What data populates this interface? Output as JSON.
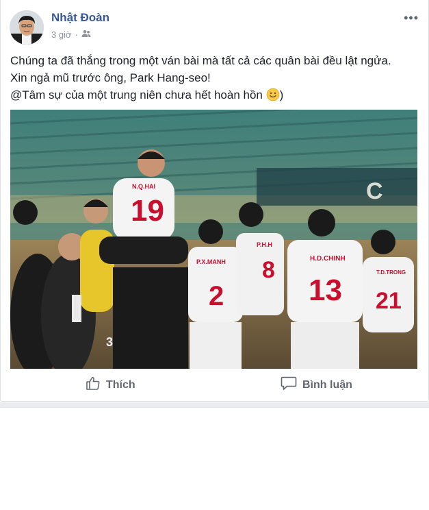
{
  "post": {
    "author": "Nhật Đoàn",
    "time": "3 giờ",
    "separator": "·",
    "privacy_icon": "friends-icon",
    "more_icon": "more-options-icon",
    "more_glyph": "•••",
    "lines": [
      "Chúng ta đã thắng trong một ván bài mà tất cả các quân bài đều lật ngửa.",
      "Xin ngả mũ trước ông, Park Hang-seo!"
    ],
    "line3_before_emoji": "@Tâm sự của một trung niên chưa hết hoàn hồn ",
    "line3_after_emoji": ")",
    "emoji_icon": "smile-emoji-icon"
  },
  "photo": {
    "jerseys": [
      {
        "name": "N.Q.HAI",
        "number": "19"
      },
      {
        "name": "P.X.MANH",
        "number": "2"
      },
      {
        "name": "P.H.H",
        "number": "8"
      },
      {
        "name": "H.D.CHINH",
        "number": "13"
      },
      {
        "name": "T.D.TRONG",
        "number": "21"
      }
    ],
    "shorts_number": "3",
    "stadium_letter": "C"
  },
  "actions": {
    "like_label": "Thích",
    "comment_label": "Bình luận",
    "like_icon": "thumbs-up-icon",
    "comment_icon": "comment-bubble-icon"
  },
  "colors": {
    "author": "#365899",
    "meta": "#90949c",
    "action": "#606770",
    "jersey_number": "#c8102e"
  }
}
